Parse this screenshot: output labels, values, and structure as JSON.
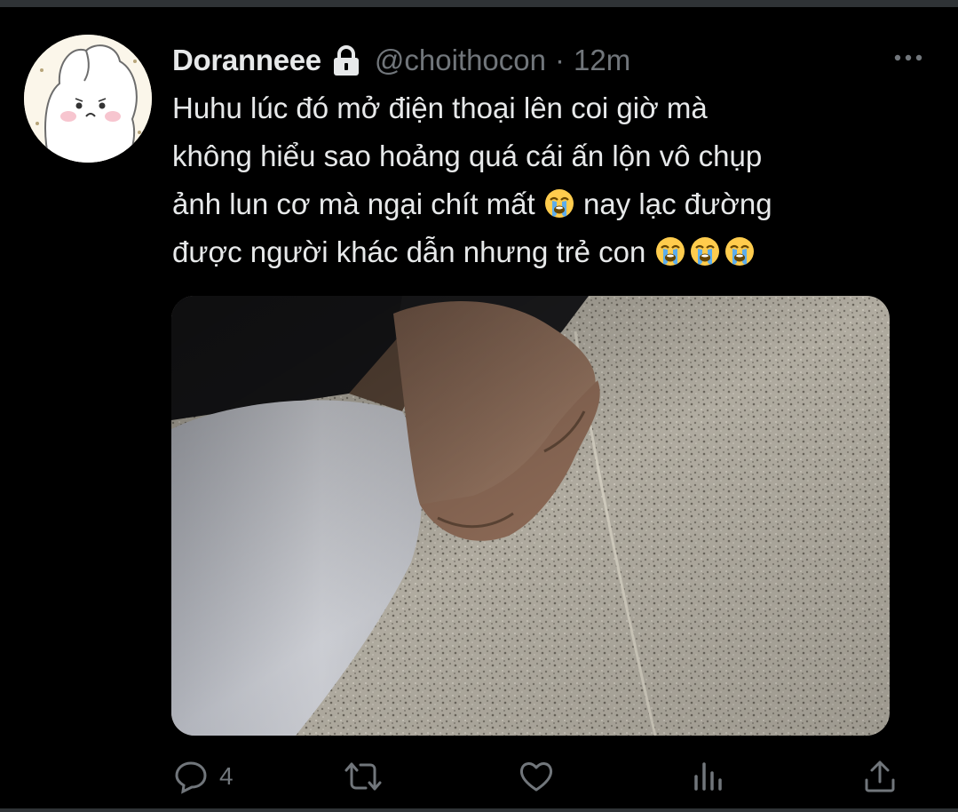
{
  "tweet": {
    "author": {
      "display_name": "Doranneee",
      "handle": "@choithocon",
      "protected_icon": "lock-icon"
    },
    "separator": "·",
    "timestamp": "12m",
    "text": {
      "line1": "Huhu lúc đó mở điện thoại lên coi giờ mà",
      "line2": "không hiểu sao hoảng quá cái ấn lộn vô chụp",
      "line3_before_emoji": "ảnh lun cơ mà ngại chít mất ",
      "line3_after_emoji": " nay lạc đường",
      "line4": "được người khác dẫn nhưng trẻ con "
    },
    "emoji": "loudly-crying-face",
    "media_description_icon": "photo",
    "actions": {
      "reply": {
        "icon": "reply-icon",
        "count": "4"
      },
      "retweet": {
        "icon": "retweet-icon"
      },
      "like": {
        "icon": "heart-icon"
      },
      "views": {
        "icon": "analytics-icon"
      },
      "share": {
        "icon": "share-icon"
      }
    }
  },
  "colors": {
    "background": "#000000",
    "text_primary": "#e7e9ea",
    "text_secondary": "#71767b",
    "border": "#2f3336"
  }
}
